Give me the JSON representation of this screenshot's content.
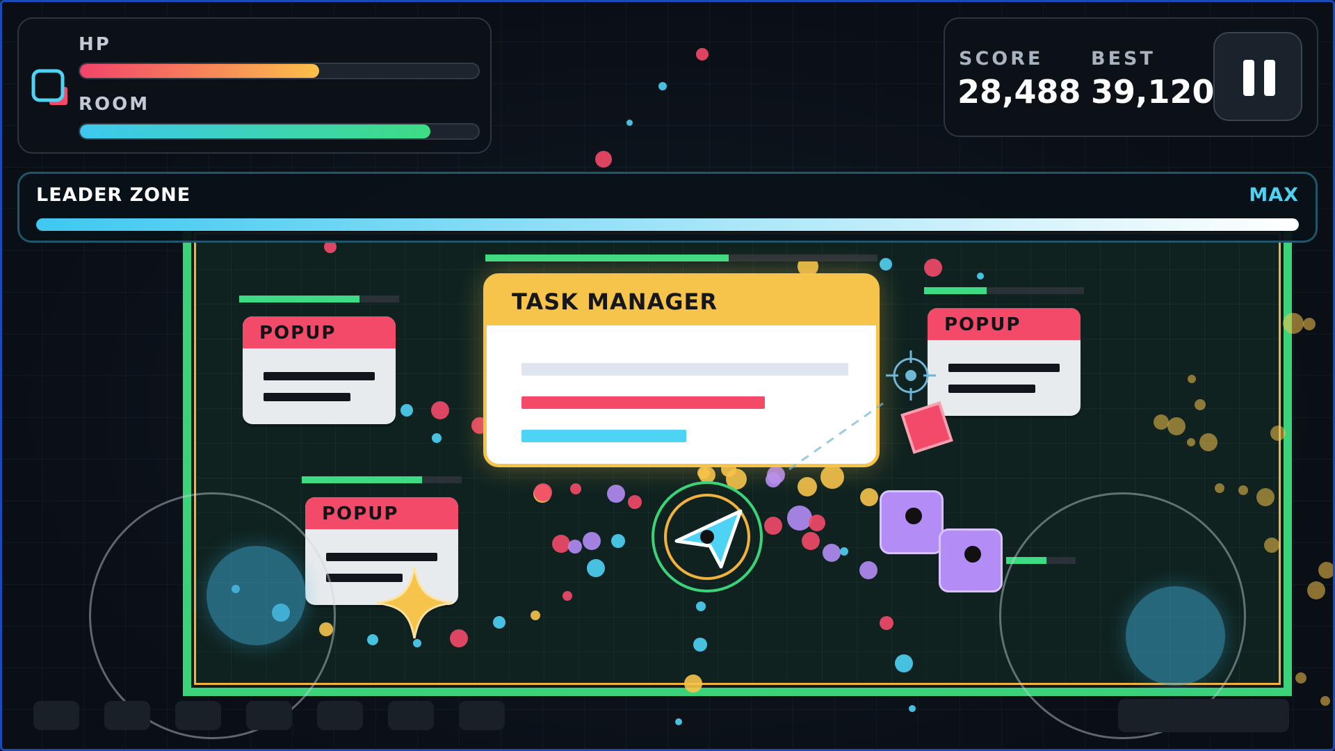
{
  "hud": {
    "hp_label": "HP",
    "hp_value": 0.6,
    "room_label": "ROOM",
    "room_value": 0.88,
    "score_label": "SCORE",
    "score_value": "28,488",
    "best_label": "BEST",
    "best_value": "39,120"
  },
  "leader_zone": {
    "label": "LEADER ZONE",
    "status": "MAX",
    "progress": 1.0
  },
  "windows": {
    "task_manager_title": "TASK MANAGER",
    "popup_1_title": "POPUP",
    "popup_2_title": "POPUP",
    "popup_3_title": "POPUP",
    "popup_1_health": 0.75,
    "popup_2_health": 0.75,
    "popup_3_health": 0.39,
    "task_manager_health": 0.62
  },
  "colors": {
    "hp_gradient_start": "#f2436b",
    "hp_gradient_end": "#fbc04a",
    "room_gradient_start": "#3fc8f0",
    "room_gradient_end": "#3ddc84",
    "accent_cyan": "#4fd3f5",
    "arena_border": "#3bd27a",
    "task_manager_yellow": "#f6c34b",
    "popup_red": "#f34a6a",
    "enemy_purple": "#b48cf5"
  },
  "icons": {
    "pause": "pause-icon",
    "player": "arrow-cursor-icon",
    "crosshair": "crosshair-icon",
    "app_logo": "window-stack-icon",
    "star_pickup": "diamond-star-icon"
  }
}
